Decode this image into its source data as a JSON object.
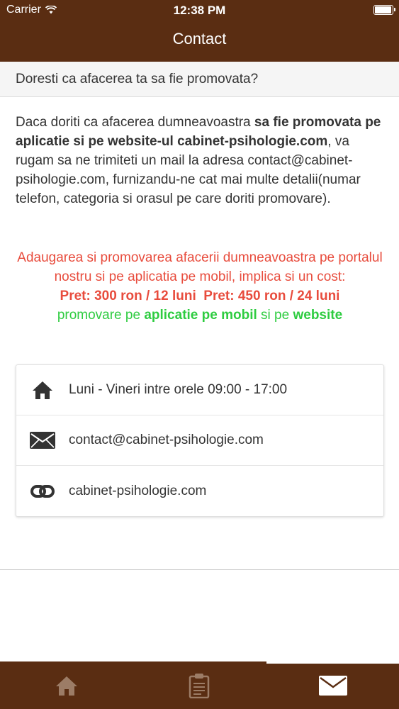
{
  "status_bar": {
    "carrier": "Carrier",
    "time": "12:38 PM",
    "battery_level": 0.95
  },
  "header": {
    "title": "Contact"
  },
  "section": {
    "title": "Doresti ca afacerea ta sa fie promovata?"
  },
  "intro": {
    "text_1": "Daca doriti ca afacerea dumneavoastra ",
    "bold_1": "sa fie promovata pe aplicatie si pe website-ul cabinet-psihologie.com",
    "text_2": ", va rugam sa ne trimiteti un mail la adresa contact@cabinet-psihologie.com, furnizandu-ne cat mai multe detalii(numar telefon, categoria si orasul pe care doriti promovare)."
  },
  "promo": {
    "line": "Adaugarea si promovarea afacerii dumneavoastra pe portalul nostru si pe aplicatia pe mobil, implica si un cost:",
    "price_1": "Pret: 300 ron / 12 luni",
    "price_2": "Pret: 450 ron / 24 luni",
    "green_1": "promovare pe ",
    "green_bold_1": "aplicatie pe mobil",
    "green_2": " si pe ",
    "green_bold_2": "website"
  },
  "info": {
    "hours": "Luni - Vineri intre orele 09:00 - 17:00",
    "email": "contact@cabinet-psihologie.com",
    "website": "cabinet-psihologie.com"
  },
  "tabs": [
    {
      "icon": "home-icon",
      "active": false
    },
    {
      "icon": "clipboard-icon",
      "active": false
    },
    {
      "icon": "envelope-icon",
      "active": true
    }
  ],
  "colors": {
    "brand": "#5a2d12",
    "price_red": "#e84c3d",
    "promo_green": "#2ecc40"
  }
}
